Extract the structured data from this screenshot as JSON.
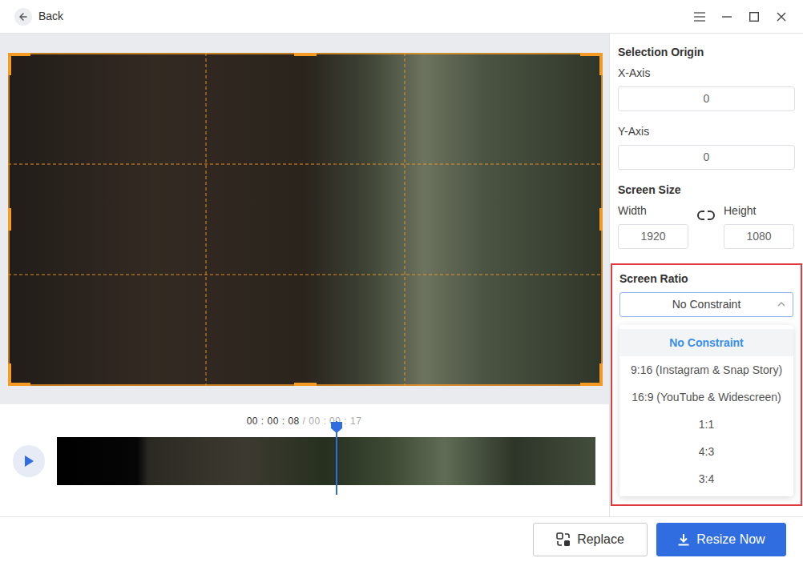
{
  "header": {
    "back": "Back"
  },
  "timeline": {
    "current": "00 : 00 : 08",
    "separator": "/",
    "total": "00 : 00 : 17",
    "level": 0.52,
    "playing": false
  },
  "panel": {
    "selection_origin": {
      "title": "Selection Origin",
      "x_label": "X-Axis",
      "x_value": "0",
      "y_label": "Y-Axis",
      "y_value": "0"
    },
    "screen_size": {
      "title": "Screen Size",
      "width_label": "Width",
      "width_value": "1920",
      "height_label": "Height",
      "height_value": "1080"
    },
    "screen_ratio": {
      "title": "Screen Ratio",
      "value": "No Constraint",
      "expanded": true,
      "options": [
        {
          "label": "No Constraint",
          "selected": true
        },
        {
          "label": "9:16 (Instagram & Snap Story)",
          "selected": false
        },
        {
          "label": "16:9 (YouTube & Widescreen)",
          "selected": false
        },
        {
          "label": "1:1",
          "selected": false
        },
        {
          "label": "4:3",
          "selected": false
        },
        {
          "label": "3:4",
          "selected": false
        }
      ]
    }
  },
  "buttons": [
    {
      "label": "Replace",
      "kind": "outline"
    },
    {
      "label": "Resize Now",
      "kind": "primary"
    }
  ]
}
